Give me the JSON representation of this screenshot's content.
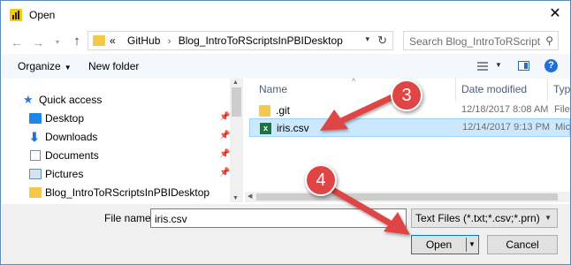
{
  "window": {
    "title": "Open",
    "close_glyph": "✕"
  },
  "address": {
    "overflow": "«",
    "crumbs": [
      "GitHub",
      "Blog_IntroToRScriptsInPBIDesktop"
    ],
    "separator": "›"
  },
  "search": {
    "placeholder": "Search Blog_IntroToRScriptsIn..."
  },
  "toolbar": {
    "organize_label": "Organize",
    "new_folder_label": "New folder",
    "help_glyph": "?"
  },
  "sidebar": {
    "items": [
      {
        "label": "Quick access",
        "icon": "star-icon"
      },
      {
        "label": "Desktop",
        "icon": "desktop-icon",
        "pinned": true
      },
      {
        "label": "Downloads",
        "icon": "downloads-icon",
        "pinned": true
      },
      {
        "label": "Documents",
        "icon": "documents-icon",
        "pinned": true
      },
      {
        "label": "Pictures",
        "icon": "pictures-icon",
        "pinned": true
      },
      {
        "label": "Blog_IntroToRScriptsInPBIDesktop",
        "icon": "folder-icon"
      }
    ]
  },
  "file_list": {
    "columns": [
      "Name",
      "Date modified",
      "Typ"
    ],
    "rows": [
      {
        "name": ".git",
        "date": "12/18/2017 8:08 AM",
        "type": "File",
        "icon": "folder-icon",
        "selected": false
      },
      {
        "name": "iris.csv",
        "date": "12/14/2017 9:13 PM",
        "type": "Mic",
        "icon": "excel-csv-icon",
        "selected": true
      }
    ]
  },
  "bottom": {
    "file_name_label": "File name:",
    "file_name_value": "iris.csv",
    "filter_value": "Text Files (*.txt;*.csv;*.prn)",
    "open_label": "Open",
    "cancel_label": "Cancel"
  },
  "annotations": {
    "step3": "3",
    "step4": "4",
    "color": "#e04545"
  }
}
